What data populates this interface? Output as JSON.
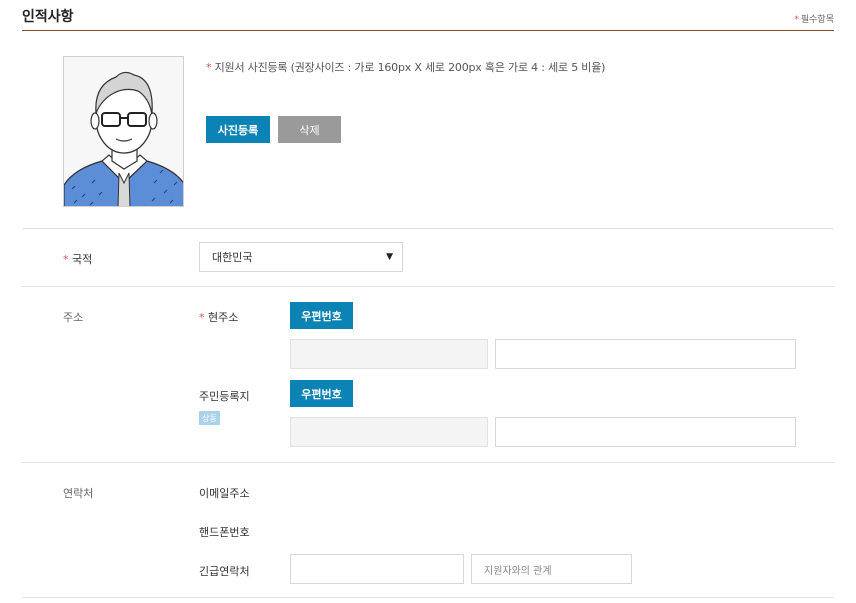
{
  "header": {
    "title": "인적사항",
    "required_marker": "*",
    "required_label": "필수항목"
  },
  "photo": {
    "required_marker": "*",
    "note": "지원서 사진등록 (권장사이즈 : 가로 160px X 세로 200px 혹은 가로 4 : 세로 5 비율)",
    "register_button": "사진등록",
    "delete_button": "삭제"
  },
  "nationality": {
    "required_marker": "*",
    "label": "국적",
    "selected": "대한민국"
  },
  "address": {
    "label": "주소",
    "current": {
      "required_marker": "*",
      "label": "현주소",
      "postcode_button": "우편번호"
    },
    "registered": {
      "label": "주민등록지",
      "same_badge": "상동",
      "postcode_button": "우편번호"
    }
  },
  "contact": {
    "label": "연락처",
    "email_label": "이메일주소",
    "phone_label": "핸드폰번호",
    "emergency_label": "긴급연락처",
    "relation_placeholder": "지원자와의 관계"
  },
  "colors": {
    "accent_blue": "#0c83b5",
    "required_red": "#d9534f",
    "title_rule": "#8a4a2a"
  }
}
